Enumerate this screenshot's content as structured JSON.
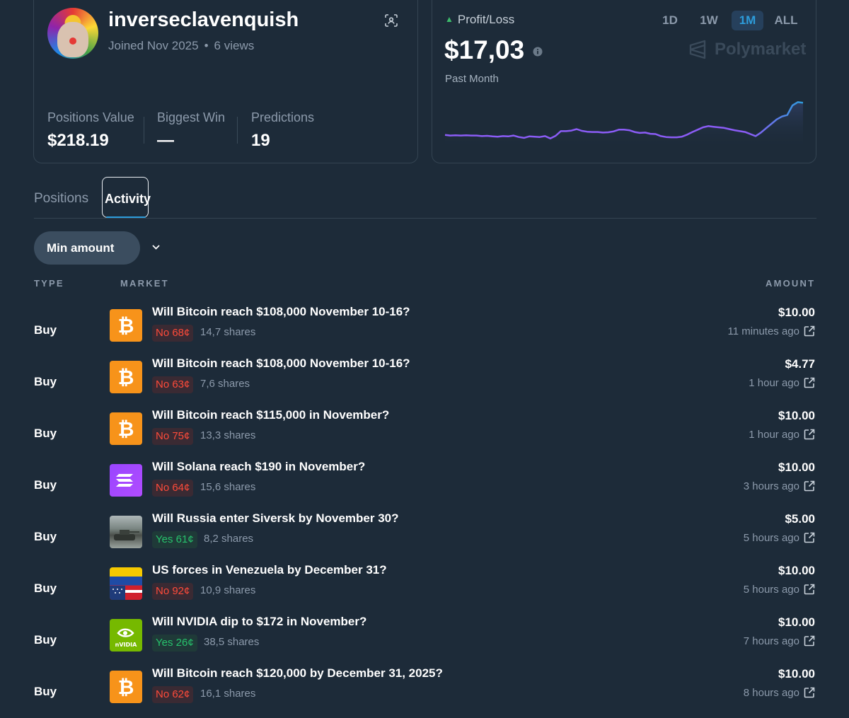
{
  "profile": {
    "username": "inverseclavenquish",
    "joined": "Joined Nov 2025",
    "views": "6 views",
    "stats": [
      {
        "label": "Positions Value",
        "value": "$218.19"
      },
      {
        "label": "Biggest Win",
        "value": "—"
      },
      {
        "label": "Predictions",
        "value": "19"
      }
    ]
  },
  "pnl": {
    "title": "Profit/Loss",
    "value": "$17,03",
    "period_label": "Past Month",
    "ranges": [
      "1D",
      "1W",
      "1M",
      "ALL"
    ],
    "active_range": "1M",
    "brand": "Polymarket",
    "colors": {
      "line": "#8b5cf6",
      "line_end": "#2d9cdb",
      "up": "#3dbb6b"
    },
    "series": [
      0.32,
      0.3,
      0.31,
      0.3,
      0.31,
      0.3,
      0.3,
      0.28,
      0.29,
      0.27,
      0.26,
      0.28,
      0.27,
      0.3,
      0.25,
      0.22,
      0.27,
      0.26,
      0.25,
      0.28,
      0.2,
      0.29,
      0.45,
      0.45,
      0.47,
      0.52,
      0.46,
      0.43,
      0.42,
      0.42,
      0.4,
      0.41,
      0.44,
      0.5,
      0.5,
      0.48,
      0.42,
      0.39,
      0.4,
      0.36,
      0.35,
      0.28,
      0.25,
      0.24,
      0.24,
      0.26,
      0.33,
      0.42,
      0.5,
      0.58,
      0.62,
      0.6,
      0.58,
      0.56,
      0.52,
      0.48,
      0.45,
      0.42,
      0.35,
      0.28,
      0.4,
      0.55,
      0.7,
      0.85,
      0.95,
      1.0,
      1.33,
      1.44,
      1.42
    ]
  },
  "tabs": {
    "positions": "Positions",
    "activity": "Activity"
  },
  "filter": {
    "min_amount": "Min amount"
  },
  "table": {
    "headers": {
      "type": "TYPE",
      "market": "MARKET",
      "amount": "AMOUNT"
    },
    "rows": [
      {
        "type": "Buy",
        "icon": "bitcoin-icon",
        "market": "Will Bitcoin reach $108,000 November 10-16?",
        "outcome": "No 68¢",
        "side": "no",
        "shares": "14,7 shares",
        "amount": "$10.00",
        "time": "11 minutes ago"
      },
      {
        "type": "Buy",
        "icon": "bitcoin-icon",
        "market": "Will Bitcoin reach $108,000 November 10-16?",
        "outcome": "No 63¢",
        "side": "no",
        "shares": "7,6 shares",
        "amount": "$4.77",
        "time": "1 hour ago"
      },
      {
        "type": "Buy",
        "icon": "bitcoin-icon",
        "market": "Will Bitcoin reach $115,000 in November?",
        "outcome": "No 75¢",
        "side": "no",
        "shares": "13,3 shares",
        "amount": "$10.00",
        "time": "1 hour ago"
      },
      {
        "type": "Buy",
        "icon": "solana-icon",
        "market": "Will Solana reach $190 in November?",
        "outcome": "No 64¢",
        "side": "no",
        "shares": "15,6 shares",
        "amount": "$10.00",
        "time": "3 hours ago"
      },
      {
        "type": "Buy",
        "icon": "russia-tank-image",
        "market": "Will Russia enter Siversk by November 30?",
        "outcome": "Yes 61¢",
        "side": "yes",
        "shares": "8,2 shares",
        "amount": "$5.00",
        "time": "5 hours ago"
      },
      {
        "type": "Buy",
        "icon": "us-venezuela-flags-image",
        "market": "US forces in Venezuela by December 31?",
        "outcome": "No 92¢",
        "side": "no",
        "shares": "10,9 shares",
        "amount": "$10.00",
        "time": "5 hours ago"
      },
      {
        "type": "Buy",
        "icon": "nvidia-icon",
        "market": "Will NVIDIA dip to $172 in November?",
        "outcome": "Yes 26¢",
        "side": "yes",
        "shares": "38,5 shares",
        "amount": "$10.00",
        "time": "7 hours ago"
      },
      {
        "type": "Buy",
        "icon": "bitcoin-icon",
        "market": "Will Bitcoin reach $120,000 by December 31, 2025?",
        "outcome": "No 62¢",
        "side": "no",
        "shares": "16,1 shares",
        "amount": "$10.00",
        "time": "8 hours ago"
      }
    ]
  }
}
